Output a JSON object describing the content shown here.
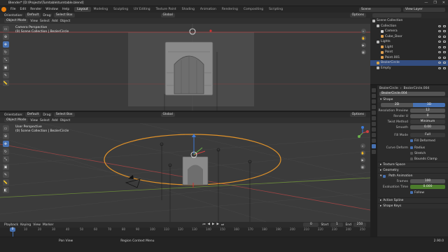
{
  "title": "Blender* [D:\\Projects\\Turntable\\turntable.blend]",
  "window_controls": [
    "—",
    "❐",
    "✕"
  ],
  "menu": [
    "File",
    "Edit",
    "Render",
    "Window",
    "Help"
  ],
  "workspaces": [
    "Layout",
    "Modeling",
    "Sculpting",
    "UV Editing",
    "Texture Paint",
    "Shading",
    "Animation",
    "Rendering",
    "Compositing",
    "Scripting"
  ],
  "active_workspace": "Layout",
  "scene": "Scene",
  "view_layer": "View Layer",
  "top_header": {
    "orientation_label": "Orientation:",
    "orientation": "Default",
    "drag_label": "Drag:",
    "drag": "Select Box",
    "transform": "Global",
    "options": "Options"
  },
  "top_view_header": [
    "Object Mode",
    "View",
    "Select",
    "Add",
    "Object"
  ],
  "top_view_text": [
    "Camera Perspective",
    "(0) Scene Collection | BezierCircle"
  ],
  "bottom_header": {
    "orientation_label": "Orientation:",
    "orientation": "Default",
    "drag_label": "Drag:",
    "drag": "Select Box",
    "transform": "Global",
    "options": "Options"
  },
  "bottom_view_header": [
    "Object Mode",
    "View",
    "Select",
    "Add",
    "Object"
  ],
  "bottom_view_text": [
    "User Perspective",
    "(0) Scene Collection | BezierCircle"
  ],
  "outliner": {
    "root": "Scene Collection",
    "items": [
      {
        "label": "Collection",
        "indent": 1,
        "color": "#bbbbbb",
        "selected": false
      },
      {
        "label": "Camera",
        "indent": 2,
        "color": "#d0d0d0",
        "selected": false
      },
      {
        "label": "Cube_Door",
        "indent": 2,
        "color": "#e0a050",
        "selected": false
      },
      {
        "label": "Lights",
        "indent": 1,
        "color": "#bbbbbb",
        "selected": false
      },
      {
        "label": "Light",
        "indent": 2,
        "color": "#e0a050",
        "selected": false
      },
      {
        "label": "Point",
        "indent": 2,
        "color": "#e0a050",
        "selected": false
      },
      {
        "label": "Point.001",
        "indent": 2,
        "color": "#e0a050",
        "selected": false
      },
      {
        "label": "BezierCircle",
        "indent": 1,
        "color": "#d9a64a",
        "selected": true
      },
      {
        "label": "Empty",
        "indent": 1,
        "color": "#bbbbbb",
        "selected": false
      }
    ]
  },
  "properties": {
    "breadcrumb_object": "BezierCircle",
    "breadcrumb_data": "BezierCircle.004",
    "datablock": "BezierCircle.004",
    "shape_section": "Shape",
    "dimension_2d": "2D",
    "dimension_3d": "3D",
    "resolution_preview_label": "Resolution Preview",
    "resolution_preview": "12",
    "render_u_label": "Render U",
    "render_u": "0",
    "twist_method_label": "Twist Method",
    "twist_method": "Minimum",
    "smooth_label": "Smooth",
    "smooth": "0.00",
    "fill_mode_label": "Fill Mode",
    "fill_mode": "Full",
    "fill_deformed": "Fill Deformed",
    "curve_deform_label": "Curve Deform",
    "radius": "Radius",
    "stretch": "Stretch",
    "bounds_clamp": "Bounds Clamp",
    "sections": [
      "Texture Space",
      "Geometry"
    ],
    "path_animation": "Path Animation",
    "frames_label": "Frames",
    "frames": "100",
    "evaluation_time_label": "Evaluation Time",
    "evaluation_time": "0.000",
    "follow": "Follow",
    "more_sections": [
      "Active Spline",
      "Shape Keys"
    ]
  },
  "timeline": {
    "menus": [
      "Playback",
      "Keying",
      "View",
      "Marker"
    ],
    "current_frame": "0",
    "start_label": "Start",
    "start": "1",
    "end_label": "End",
    "end": "250",
    "ticks": [
      "0",
      "10",
      "20",
      "30",
      "40",
      "50",
      "60",
      "70",
      "80",
      "90",
      "100",
      "110",
      "120",
      "130",
      "140",
      "150",
      "160",
      "170",
      "180",
      "190",
      "200",
      "210",
      "220",
      "230",
      "240",
      "250"
    ]
  },
  "status": [
    "Pan View",
    "Region Context Menu"
  ],
  "version": "2.90.0",
  "colors": {
    "accent": "#4772b3",
    "orange": "#e87d0d",
    "selection": "#334d80"
  }
}
